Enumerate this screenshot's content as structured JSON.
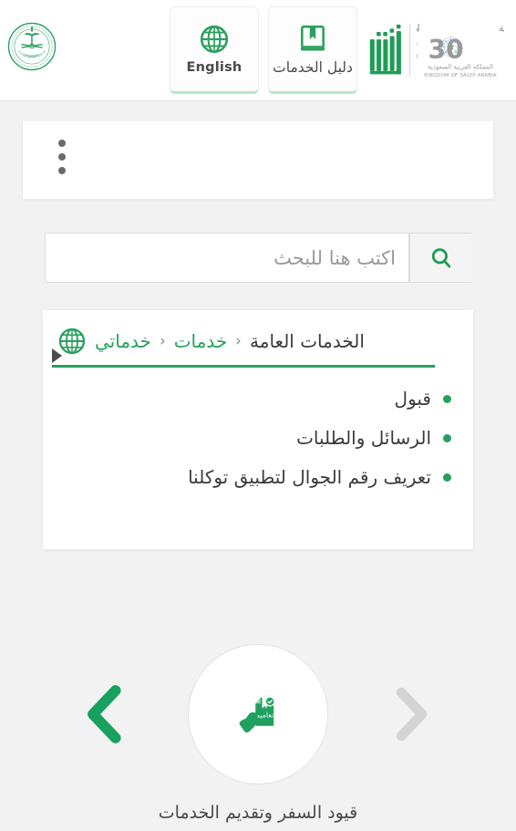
{
  "header": {
    "ministry_logo_alt": "moi-emblem",
    "buttons": [
      {
        "label": "English",
        "icon": "globe-icon"
      },
      {
        "label": "دليل الخدمات",
        "icon": "services-guide-book-icon"
      }
    ],
    "vision": {
      "word_ar": "رؤيــــة",
      "word_en": "VISION",
      "year": "2030",
      "kingdom_ar": "المملكة العربية السعودية",
      "kingdom_en": "KINGDOM OF SAUDI ARABIA"
    },
    "absher_logo_alt": "absher-logo"
  },
  "kebab_card": {
    "menu_icon": "kebab-menu-icon",
    "dots": 3
  },
  "search": {
    "placeholder": "اكتب هنا للبحث",
    "value": "",
    "button_icon": "search-icon"
  },
  "main_card": {
    "breadcrumb": {
      "globe_icon": "globe-icon",
      "arrow_icon": "play-triangle-icon",
      "items": [
        {
          "label": "خدماتي",
          "active": true
        },
        {
          "label": "خدمات",
          "active": true
        },
        {
          "label": "الخدمات العامة",
          "active": false
        }
      ],
      "separator": "›"
    },
    "links": [
      "قبول",
      "الرسائل والطلبات",
      "تعريف رقم الجوال لتطبيق توكلنا"
    ]
  },
  "carousel": {
    "prev_icon": "chevron-left-icon",
    "next_icon": "chevron-right-icon",
    "item": {
      "icon": "circulars-document-hand-icon",
      "icon_word": "تعاميم",
      "caption": "قيود السفر وتقديم الخدمات"
    }
  },
  "colors": {
    "brand_green": "#27a05c",
    "page_background": "#f2f2f2",
    "card_background": "#ffffff",
    "text_dark": "#3b3b3b",
    "text_muted": "#9a9a9a",
    "chevron_disabled": "#d4d4d4"
  }
}
